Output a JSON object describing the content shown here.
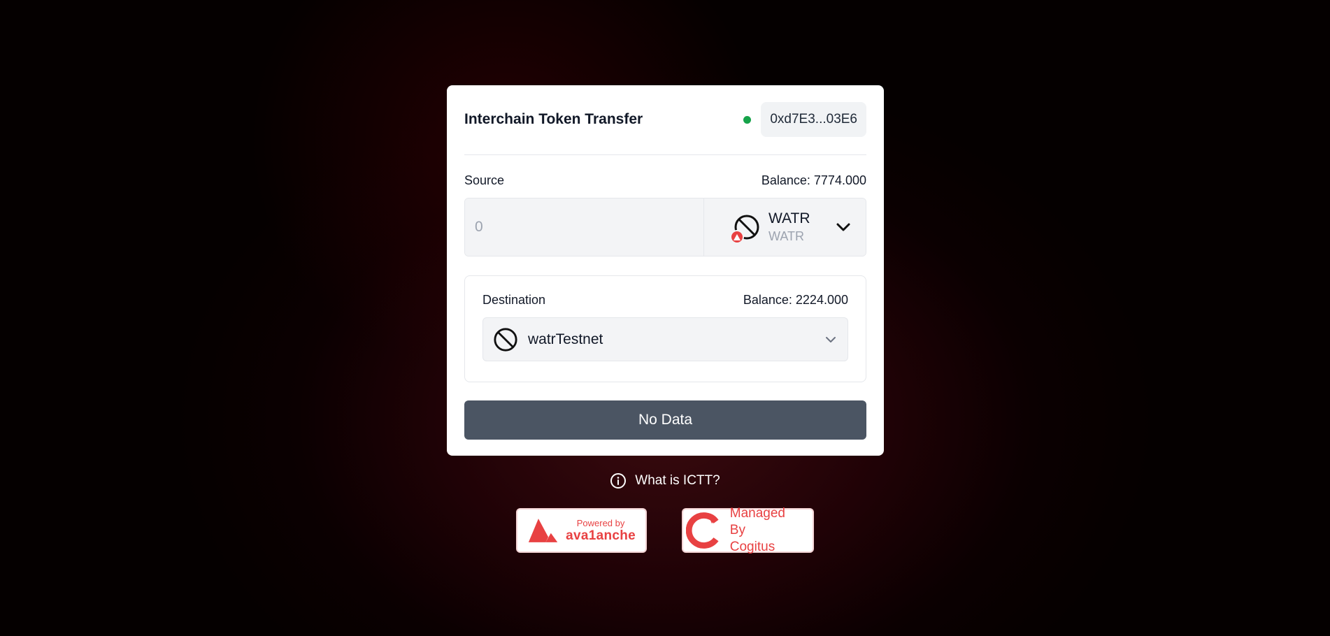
{
  "header": {
    "title": "Interchain Token Transfer",
    "wallet_address": "0xd7E3...03E6",
    "status_color": "#16a34a"
  },
  "source": {
    "label": "Source",
    "balance": "Balance: 7774.000",
    "amount_placeholder": "0",
    "token_symbol": "WATR",
    "token_name": "WATR",
    "token_icon": "block-icon",
    "chain_badge_icon": "avalanche-icon"
  },
  "destination": {
    "label": "Destination",
    "balance": "Balance: 2224.000",
    "chain_name": "watrTestnet",
    "chain_icon": "block-icon"
  },
  "action": {
    "label": "No Data"
  },
  "help": {
    "label": "What is ICTT?"
  },
  "badges": {
    "avalanche": {
      "line1": "Powered by",
      "line2": "ava1anche"
    },
    "cogitus": {
      "line1": "Managed By",
      "line2": "Cogitus"
    }
  },
  "colors": {
    "accent": "#e84142",
    "button": "#4b5563"
  }
}
